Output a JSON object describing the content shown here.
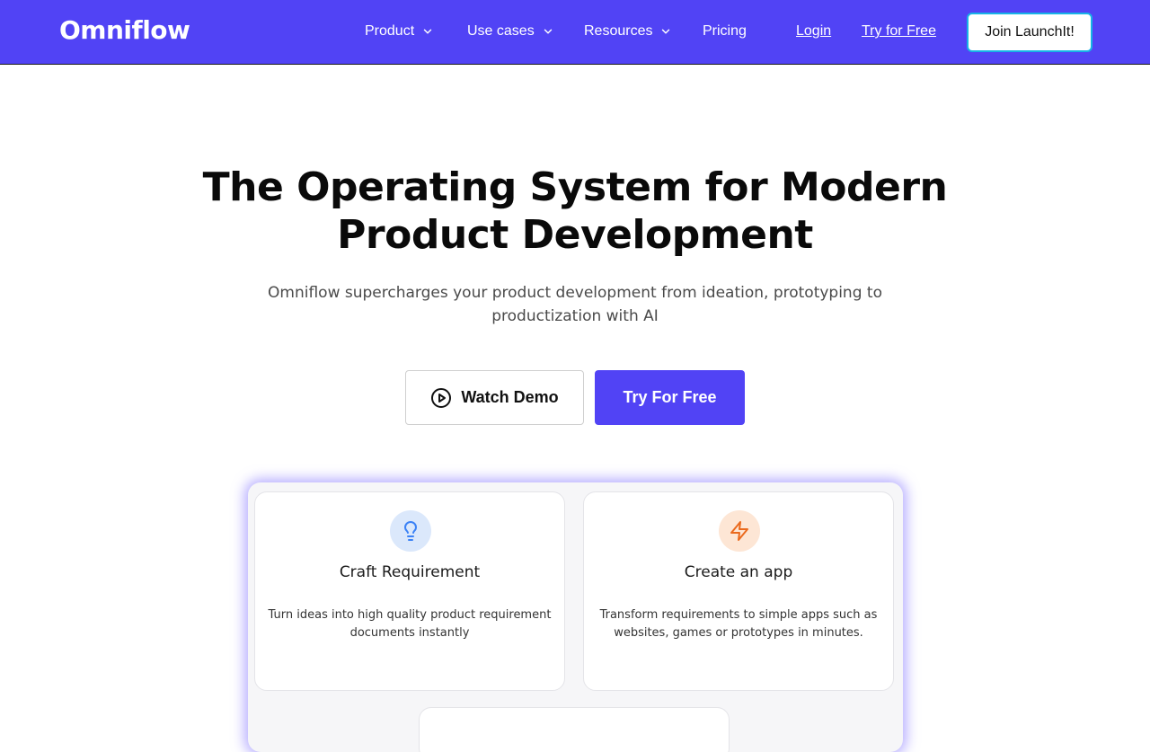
{
  "brand": {
    "name": "Omniflow"
  },
  "nav": {
    "items": [
      {
        "label": "Product",
        "has_dropdown": true
      },
      {
        "label": "Use cases",
        "has_dropdown": true
      },
      {
        "label": "Resources",
        "has_dropdown": true
      },
      {
        "label": "Pricing",
        "has_dropdown": false
      }
    ],
    "login_label": "Login",
    "try_free_label": "Try for Free",
    "join_label": "Join LaunchIt!"
  },
  "hero": {
    "title": "The Operating System for Modern Product Development",
    "subtitle": "Omniflow supercharges your product development from ideation, prototyping to productization with AI",
    "watch_demo_label": "Watch Demo",
    "try_free_label": "Try For Free"
  },
  "preview": {
    "cards": [
      {
        "icon": "lightbulb-icon",
        "title": "Craft Requirement",
        "description": "Turn ideas into high quality product requirement documents instantly"
      },
      {
        "icon": "lightning-icon",
        "title": "Create an app",
        "description": "Transform requirements to simple apps such as websites, games or prototypes in minutes."
      }
    ]
  },
  "colors": {
    "brand": "#5143F5",
    "join_border": "#17B3E6",
    "lightbulb_bg": "#dbe8fb",
    "lightning_bg": "#fde6d5",
    "lightbulb_stroke": "#3b82f6",
    "lightning_stroke": "#ea6a1e"
  }
}
